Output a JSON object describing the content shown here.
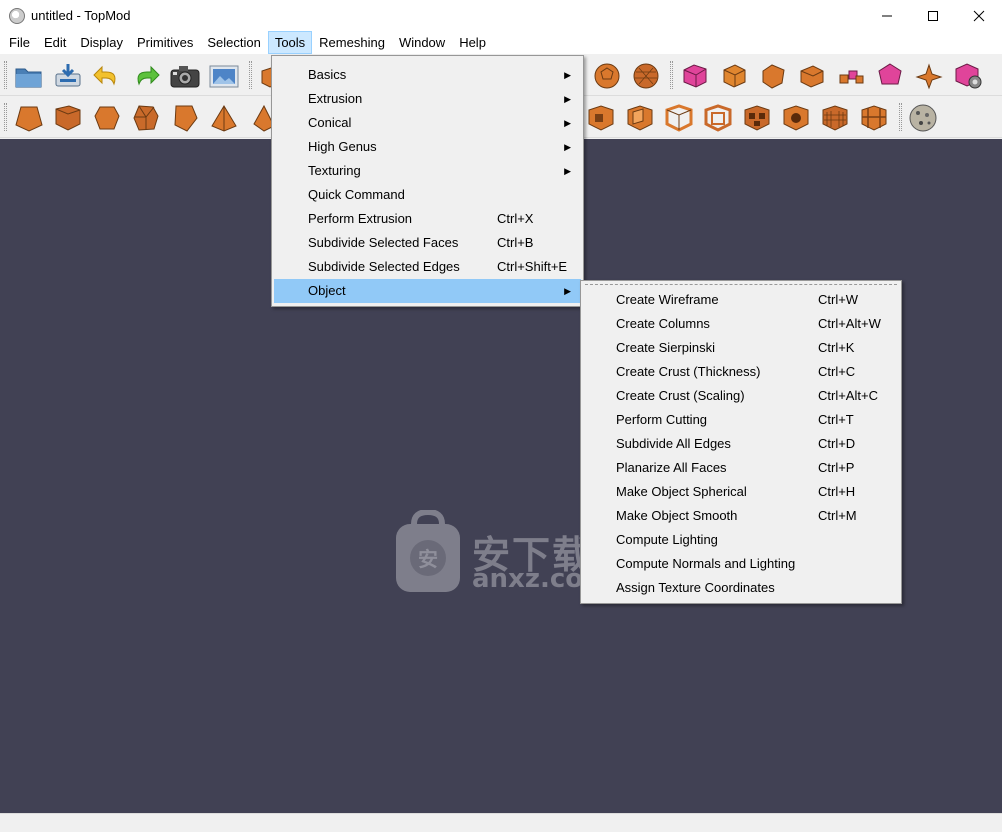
{
  "window": {
    "title": "untitled - TopMod",
    "controls": [
      "minimize-icon",
      "maximize-icon",
      "close-icon"
    ]
  },
  "menubar": {
    "items": [
      "File",
      "Edit",
      "Display",
      "Primitives",
      "Selection",
      "Tools",
      "Remeshing",
      "Window",
      "Help"
    ],
    "active": "Tools"
  },
  "toolbar1": {
    "file_buttons": [
      "open-folder-icon",
      "save-icon",
      "undo-icon",
      "redo-icon",
      "screenshot-camera-icon",
      "render-image-icon"
    ],
    "primitive_buttons": [
      "soccer-ball-icon",
      "geodesic-sphere-icon",
      "pink-cube-icon",
      "orange-cube-icon",
      "corner-cut-cube-icon",
      "edge-cube-icon",
      "cube-cluster-icon",
      "pink-dodecahedron-icon",
      "star-arms-icon",
      "settings-cube-icon"
    ]
  },
  "toolbar2": {
    "buttons": [
      "pyramid-frustum-icon",
      "box-cup-icon",
      "pentagon-solid-icon",
      "faceted-solid-icon",
      "prism-solid-icon",
      "tetra-solid-icon",
      "pyramid-icon",
      "hollow-box-icon",
      "open-box-icon",
      "frame-cube-icon",
      "lattice-cube-icon",
      "wire-cube-icon",
      "holey-cube-icon",
      "grid-cube-icon",
      "mesh-cube-icon",
      "textured-sphere-icon"
    ]
  },
  "tools_menu": {
    "items": [
      {
        "label": "Basics",
        "shortcut": "",
        "submenu": true
      },
      {
        "label": "Extrusion",
        "shortcut": "",
        "submenu": true
      },
      {
        "label": "Conical",
        "shortcut": "",
        "submenu": true
      },
      {
        "label": "High Genus",
        "shortcut": "",
        "submenu": true
      },
      {
        "label": "Texturing",
        "shortcut": "",
        "submenu": true
      },
      {
        "label": "Quick Command",
        "shortcut": "",
        "submenu": false
      },
      {
        "label": "Perform Extrusion",
        "shortcut": "Ctrl+X",
        "submenu": false
      },
      {
        "label": "Subdivide Selected Faces",
        "shortcut": "Ctrl+B",
        "submenu": false
      },
      {
        "label": "Subdivide Selected Edges",
        "shortcut": "Ctrl+Shift+E",
        "submenu": false
      },
      {
        "label": "Object",
        "shortcut": "",
        "submenu": true
      }
    ],
    "highlighted": "Object"
  },
  "object_menu": {
    "items": [
      {
        "label": "Create Wireframe",
        "shortcut": "Ctrl+W"
      },
      {
        "label": "Create Columns",
        "shortcut": "Ctrl+Alt+W"
      },
      {
        "label": "Create Sierpinski",
        "shortcut": "Ctrl+K"
      },
      {
        "label": "Create Crust (Thickness)",
        "shortcut": "Ctrl+C"
      },
      {
        "label": "Create Crust (Scaling)",
        "shortcut": "Ctrl+Alt+C"
      },
      {
        "label": "Perform Cutting",
        "shortcut": "Ctrl+T"
      },
      {
        "label": "Subdivide All Edges",
        "shortcut": "Ctrl+D"
      },
      {
        "label": "Planarize All Faces",
        "shortcut": "Ctrl+P"
      },
      {
        "label": "Make Object Spherical",
        "shortcut": "Ctrl+H"
      },
      {
        "label": "Make Object Smooth",
        "shortcut": "Ctrl+M"
      },
      {
        "label": "Compute Lighting",
        "shortcut": ""
      },
      {
        "label": "Compute Normals and Lighting",
        "shortcut": ""
      },
      {
        "label": "Assign Texture Coordinates",
        "shortcut": ""
      }
    ]
  },
  "watermark": {
    "main": "安下载",
    "sub": "anxz.com",
    "badge": "安"
  },
  "colors": {
    "viewport": "#414154",
    "menu_highlight": "#91c9f7",
    "mesh_orange": "#d9782d",
    "mesh_pink": "#e0449a"
  }
}
